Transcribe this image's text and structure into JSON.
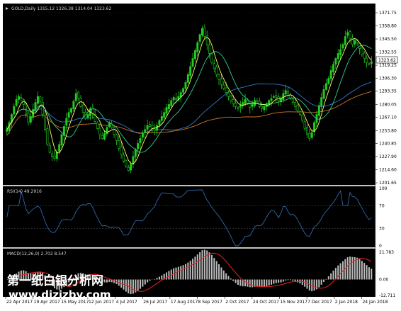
{
  "colors": {
    "background": "#000000",
    "candle_bull": "#22cc22",
    "ma_fast": "#ffff66",
    "ma_mid": "#33cc88",
    "ma_slow": "#3377cc",
    "ma_long": "#cc7722",
    "rsi_line": "#3366aa",
    "macd_hist": "#bbbbbb",
    "macd_signal": "#ee2222",
    "price_box": "#ffffff"
  },
  "price_panel": {
    "title": "GOLD,Daily  1315.12 1326.38 1314.04 1323.62",
    "current_price": "1323.62",
    "y_ticks": [
      "1371.75",
      "1358.80",
      "1345.50",
      "1332.55",
      "1319.25",
      "1306.30",
      "1293.35",
      "1280.05",
      "1267.10",
      "1253.80",
      "1240.85",
      "1227.90",
      "1214.60",
      "1201.65"
    ]
  },
  "rsi_panel": {
    "title": "RSI(14) 49.2916",
    "y_ticks": [
      "100",
      "70",
      "30",
      "0"
    ]
  },
  "macd_panel": {
    "title": "MACD(12,26,9) 2.702 8.547",
    "y_ticks": [
      "21.783",
      "0.00",
      "-12.711"
    ]
  },
  "x_axis": {
    "labels": [
      "22 Apr 2017",
      "19 Apr 2017",
      "15 May 2017",
      "12 Jun 2017",
      "4 Jul 2017",
      "26 Jul 2017",
      "17 Aug 2017",
      "8 Sep 2017",
      "2 Oct 2017",
      "24 Oct 2017",
      "15 Nov 2017",
      "7 Dec 2017",
      "2 Jan 2018",
      "24 Jan 2018"
    ]
  },
  "watermark": {
    "line1": "第一纸白银分析网",
    "line2": "www.dizizby.com"
  },
  "chart_data": {
    "type": "candlestick",
    "symbol": "GOLD",
    "timeframe": "Daily",
    "ohlc_last": {
      "open": 1315.12,
      "high": 1326.38,
      "low": 1314.04,
      "close": 1323.62
    },
    "ylim": [
      1201.65,
      1371.75
    ],
    "close_series": [
      1255,
      1262,
      1270,
      1278,
      1285,
      1288,
      1286,
      1280,
      1270,
      1262,
      1268,
      1275,
      1282,
      1288,
      1283,
      1270,
      1255,
      1240,
      1232,
      1228,
      1226,
      1232,
      1240,
      1250,
      1258,
      1266,
      1272,
      1276,
      1283,
      1291,
      1286,
      1278,
      1272,
      1266,
      1270,
      1276,
      1271,
      1263,
      1256,
      1250,
      1246,
      1251,
      1257,
      1262,
      1257,
      1250,
      1244,
      1236,
      1230,
      1223,
      1218,
      1214,
      1220,
      1228,
      1235,
      1241,
      1246,
      1251,
      1255,
      1259,
      1258,
      1256,
      1254,
      1259,
      1264,
      1268,
      1272,
      1277,
      1280,
      1284,
      1287,
      1285,
      1288,
      1292,
      1296,
      1302,
      1310,
      1318,
      1326,
      1334,
      1342,
      1350,
      1356,
      1348,
      1340,
      1331,
      1322,
      1316,
      1310,
      1305,
      1300,
      1296,
      1292,
      1288,
      1284,
      1281,
      1278,
      1276,
      1279,
      1282,
      1285,
      1281,
      1277,
      1280,
      1284,
      1283,
      1278,
      1276,
      1278,
      1281,
      1284,
      1286,
      1288,
      1287,
      1284,
      1286,
      1291,
      1294,
      1291,
      1286,
      1282,
      1278,
      1274,
      1270,
      1264,
      1256,
      1250,
      1246,
      1252,
      1262,
      1270,
      1279,
      1287,
      1295,
      1301,
      1306,
      1314,
      1320,
      1326,
      1331,
      1335,
      1340,
      1348,
      1352,
      1346,
      1340,
      1344,
      1342,
      1336,
      1330,
      1326,
      1322,
      1320,
      1323
    ],
    "rsi": {
      "value": 49.2916,
      "ylim": [
        0,
        100
      ],
      "levels": [
        70,
        30
      ]
    },
    "macd": {
      "main": 2.702,
      "signal": 8.547,
      "ylim": [
        -12.711,
        21.783
      ]
    }
  }
}
